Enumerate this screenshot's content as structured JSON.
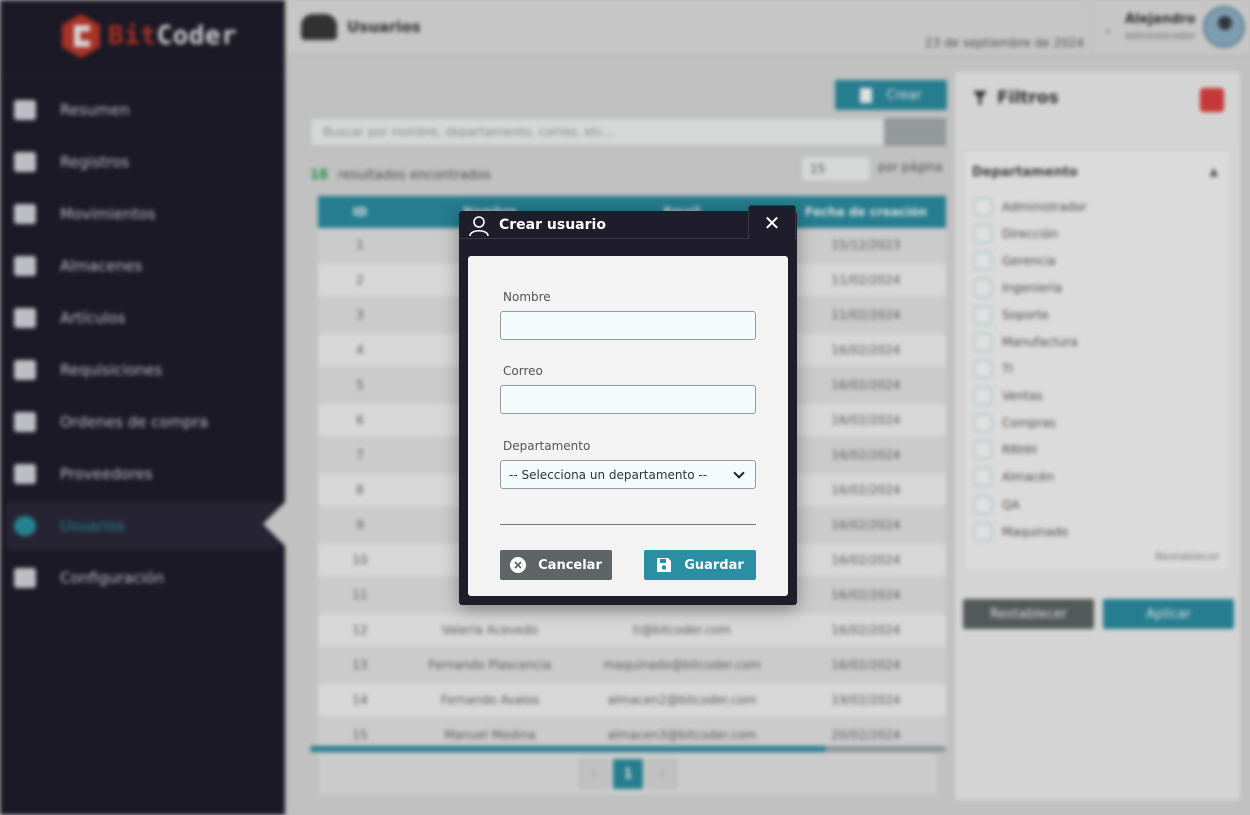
{
  "brand": {
    "bit": "Bit",
    "coder": "Coder"
  },
  "sidebar": {
    "items": [
      {
        "label": "Resumen",
        "icon": "dashboard-icon"
      },
      {
        "label": "Registros",
        "icon": "table-icon"
      },
      {
        "label": "Movimientos",
        "icon": "exchange-icon"
      },
      {
        "label": "Almacenes",
        "icon": "warehouse-icon"
      },
      {
        "label": "Artículos",
        "icon": "box-icon"
      },
      {
        "label": "Requisiciones",
        "icon": "document-icon"
      },
      {
        "label": "Ordenes de compra",
        "icon": "cart-icon"
      },
      {
        "label": "Proveedores",
        "icon": "truck-icon"
      },
      {
        "label": "Usuarios",
        "icon": "users-icon",
        "active": true
      },
      {
        "label": "Configuración",
        "icon": "gear-icon"
      }
    ]
  },
  "header": {
    "title": "Usuarios",
    "date": "23 de septiembre de 2024",
    "user_name": "Alejandro",
    "user_role": "Administrador"
  },
  "main": {
    "create_label": "Crear",
    "search_placeholder": "Buscar por nombre, departamento, correo, etc...",
    "results_count": "18",
    "results_label": "resultados encontrados",
    "per_page_value": "15",
    "per_page_label": "por página",
    "columns": [
      "ID",
      "Nombre",
      "Email",
      "Fecha de creación"
    ],
    "rows": [
      [
        "1",
        "",
        "",
        "15/12/2023"
      ],
      [
        "2",
        "",
        "",
        "11/02/2024"
      ],
      [
        "3",
        "",
        "",
        "11/02/2024"
      ],
      [
        "4",
        "",
        "",
        "16/02/2024"
      ],
      [
        "5",
        "",
        "",
        "16/02/2024"
      ],
      [
        "6",
        "",
        "",
        "16/02/2024"
      ],
      [
        "7",
        "",
        "",
        "16/02/2024"
      ],
      [
        "8",
        "",
        "",
        "16/02/2024"
      ],
      [
        "9",
        "",
        "",
        "16/02/2024"
      ],
      [
        "10",
        "",
        "",
        "16/02/2024"
      ],
      [
        "11",
        "",
        "",
        "16/02/2024"
      ],
      [
        "12",
        "Valeria Acevedo",
        "ti@bitcoder.com",
        "16/02/2024"
      ],
      [
        "13",
        "Fernando Plascencia",
        "maquinado@bitcoder.com",
        "16/02/2024"
      ],
      [
        "14",
        "Fernando Avalos",
        "almacen2@bitcoder.com",
        "19/02/2024"
      ],
      [
        "15",
        "Manuel Medina",
        "almacen3@bitcoder.com",
        "20/02/2024"
      ]
    ],
    "current_page": "1",
    "prev_label": "‹",
    "next_label": "›"
  },
  "filters": {
    "title": "Filtros",
    "section_title": "Departamento",
    "options": [
      "Administrador",
      "Dirección",
      "Gerencia",
      "Ingeniería",
      "Soporte",
      "Manufactura",
      "TI",
      "Ventas",
      "Compras",
      "RRHH",
      "Almacén",
      "QA",
      "Maquinado"
    ],
    "reset_small": "Restablecer",
    "reset_label": "Restablecer",
    "apply_label": "Aplicar"
  },
  "modal": {
    "title": "Crear usuario",
    "close_glyph": "✕",
    "name_label": "Nombre",
    "name_value": "",
    "email_label": "Correo",
    "email_value": "",
    "department_label": "Departamento",
    "department_selected": "-- Selecciona un departamento --",
    "cancel_label": "Cancelar",
    "save_label": "Guardar"
  },
  "colors": {
    "accent": "#2b8fa3",
    "sidebar": "#1f1d2b",
    "brand_red": "#c0392b",
    "cancel": "#5f6566"
  }
}
